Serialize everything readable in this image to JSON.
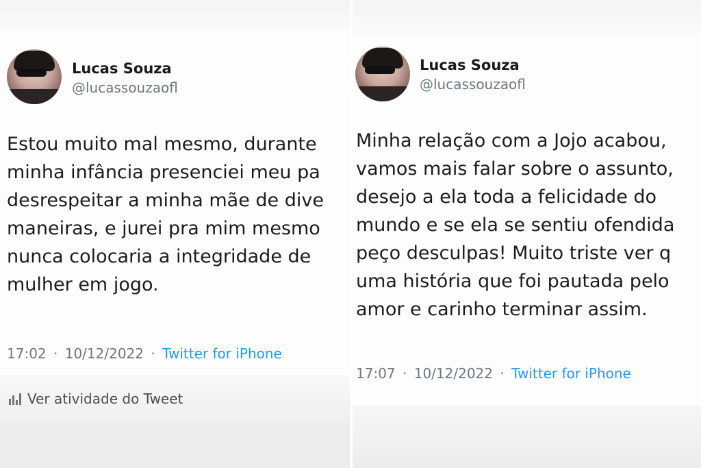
{
  "left_tweet": {
    "author_name": "Lucas Souza",
    "author_handle": "@lucassouzaofl",
    "text_lines": [
      "Estou muito mal mesmo, durante",
      "minha infância presenciei meu pa",
      "desrespeitar a minha mãe de dive",
      "maneiras, e jurei pra mim mesmo",
      "nunca colocaria a integridade de",
      "mulher em jogo."
    ],
    "time": "17:02",
    "date": "10/12/2022",
    "separator": "·",
    "source": "Twitter for iPhone",
    "activity_label": "Ver atividade do Tweet",
    "activity_icon": "stats-icon"
  },
  "right_tweet": {
    "author_name": "Lucas Souza",
    "author_handle": "@lucassouzaofl",
    "text_lines": [
      "Minha relação com a Jojo acabou,",
      "vamos mais falar sobre o assunto,",
      "desejo a ela toda a felicidade do",
      "mundo e se ela se sentiu ofendida",
      "peço desculpas! Muito triste ver q",
      "uma história que foi pautada pelo",
      "amor e carinho terminar assim."
    ],
    "time": "17:07",
    "date": "10/12/2022",
    "separator": "·",
    "source": "Twitter for iPhone"
  },
  "colors": {
    "link": "#1d9bf0",
    "secondary_text": "#6e767d",
    "primary_text": "#1c1c1c"
  }
}
